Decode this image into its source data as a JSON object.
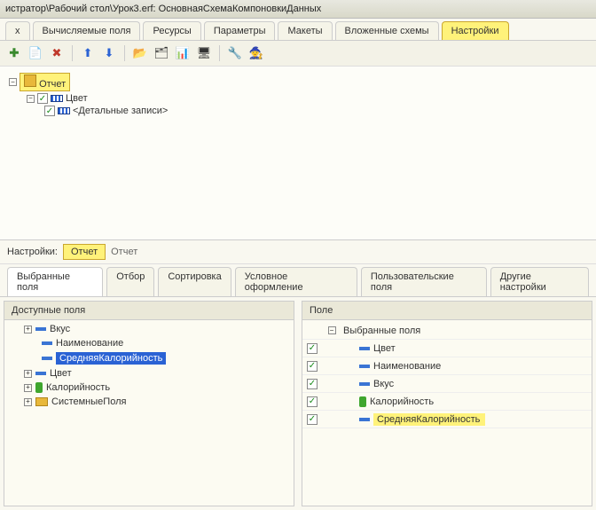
{
  "title": "истратор\\Рабочий стол\\Урок3.erf: ОсновнаяСхемаКомпоновкиДанных",
  "main_tabs": [
    {
      "label": "х"
    },
    {
      "label": "Вычисляемые поля"
    },
    {
      "label": "Ресурсы"
    },
    {
      "label": "Параметры"
    },
    {
      "label": "Макеты"
    },
    {
      "label": "Вложенные схемы"
    },
    {
      "label": "Настройки",
      "active": true
    }
  ],
  "tree": {
    "root": "Отчет",
    "child1": "Цвет",
    "child2": "<Детальные записи>"
  },
  "settings": {
    "label": "Настройки:",
    "tabs": [
      {
        "label": "Отчет",
        "active": true
      },
      {
        "label": "Отчет"
      }
    ]
  },
  "sub_tabs": [
    {
      "label": "Выбранные поля",
      "active": true
    },
    {
      "label": "Отбор"
    },
    {
      "label": "Сортировка"
    },
    {
      "label": "Условное оформление"
    },
    {
      "label": "Пользовательские поля"
    },
    {
      "label": "Другие настройки"
    }
  ],
  "left_header": "Доступные поля",
  "left_fields": [
    {
      "label": "Вкус",
      "expandable": true,
      "icon": "dash"
    },
    {
      "label": "Наименование",
      "icon": "dash"
    },
    {
      "label": "СредняяКалорийность",
      "icon": "dash",
      "selected": true
    },
    {
      "label": "Цвет",
      "expandable": true,
      "icon": "dash"
    },
    {
      "label": "Калорийность",
      "expandable": true,
      "icon": "green"
    },
    {
      "label": "СистемныеПоля",
      "expandable": true,
      "icon": "folder"
    }
  ],
  "right_header": "Поле",
  "right_fields": {
    "group": "Выбранные поля",
    "items": [
      {
        "label": "Цвет"
      },
      {
        "label": "Наименование"
      },
      {
        "label": "Вкус"
      },
      {
        "label": "Калорийность",
        "icon": "green"
      },
      {
        "label": "СредняяКалорийность",
        "highlight": true
      }
    ]
  }
}
